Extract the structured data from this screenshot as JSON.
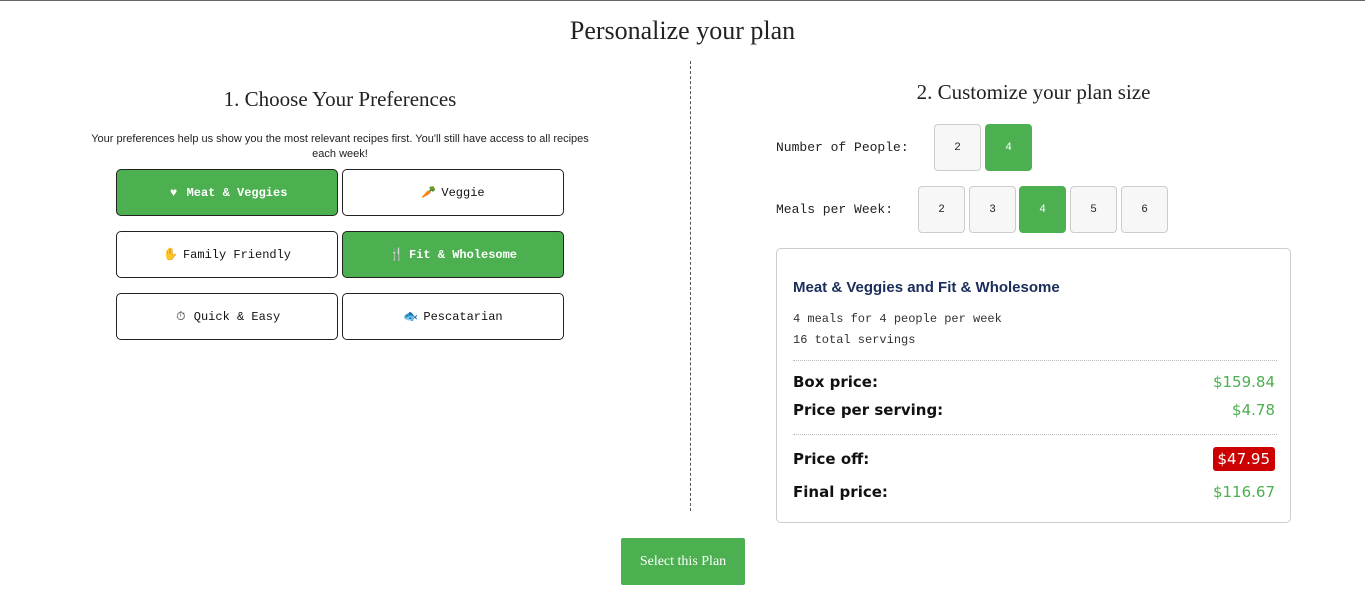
{
  "page": {
    "title": "Personalize your plan"
  },
  "preferences": {
    "title": "1. Choose Your Preferences",
    "description": "Your preferences help us show you the most relevant recipes first. You'll still have access to all recipes each week!",
    "options": [
      {
        "label": "Meat & Veggies",
        "icon": "heart-icon",
        "glyph": "♥",
        "selected": true
      },
      {
        "label": "Veggie",
        "icon": "carrot-icon",
        "glyph": "🥕",
        "selected": false
      },
      {
        "label": "Family Friendly",
        "icon": "person-icon",
        "glyph": "✋",
        "selected": false
      },
      {
        "label": "Fit & Wholesome",
        "icon": "utensils-icon",
        "glyph": "🍴",
        "selected": true
      },
      {
        "label": "Quick & Easy",
        "icon": "stopwatch-icon",
        "glyph": "⏱",
        "selected": false
      },
      {
        "label": "Pescatarian",
        "icon": "fish-icon",
        "glyph": "🐟",
        "selected": false
      }
    ]
  },
  "plan_size": {
    "title": "2. Customize your plan size",
    "people": {
      "label": "Number of People:",
      "options": [
        "2",
        "4"
      ],
      "selected": "4"
    },
    "meals": {
      "label": "Meals per Week:",
      "options": [
        "2",
        "3",
        "4",
        "5",
        "6"
      ],
      "selected": "4"
    }
  },
  "summary": {
    "plan_name": "Meat & Veggies and Fit & Wholesome",
    "meals_line": "4 meals for 4 people per week",
    "servings_line": "16 total servings",
    "box_price_label": "Box price:",
    "box_price": "$159.84",
    "per_serving_label": "Price per serving:",
    "per_serving": "$4.78",
    "price_off_label": "Price off:",
    "price_off": "$47.95",
    "final_label": "Final price:",
    "final_price": "$116.67"
  },
  "cta": {
    "label": "Select this Plan"
  },
  "colors": {
    "accent": "#4caf50",
    "discount": "#cc0000",
    "title_blue": "#1a2d5a"
  }
}
